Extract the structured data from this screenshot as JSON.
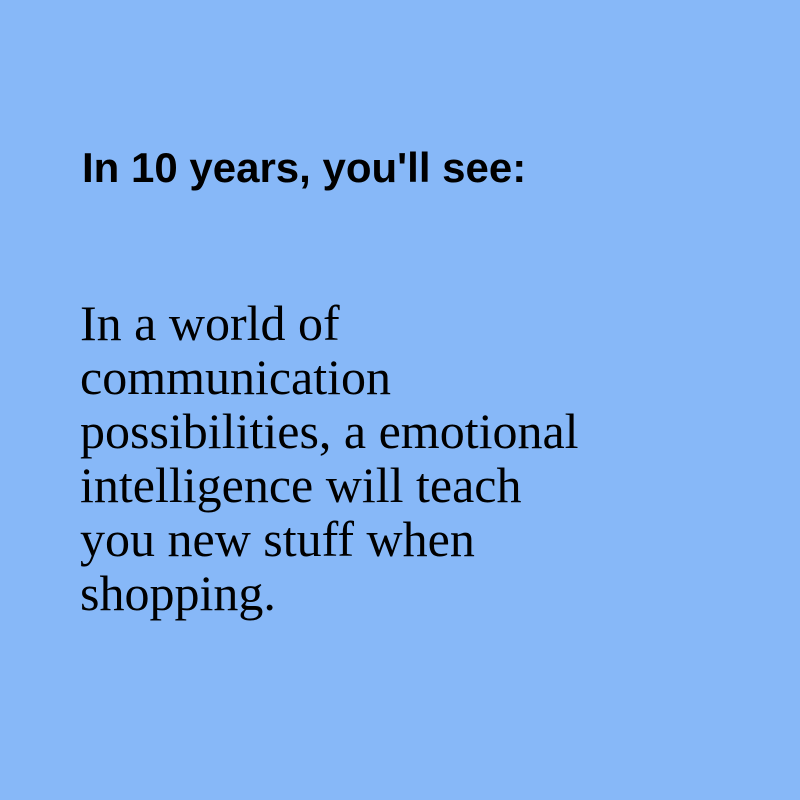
{
  "background_color": "#87b8f8",
  "text_color": "#000000",
  "headline": "In 10 years, you'll see:",
  "body_lines": [
    "In a world of",
    "communication",
    "possibilities, a emotional",
    "intelligence will teach",
    "you new stuff when",
    "shopping."
  ]
}
